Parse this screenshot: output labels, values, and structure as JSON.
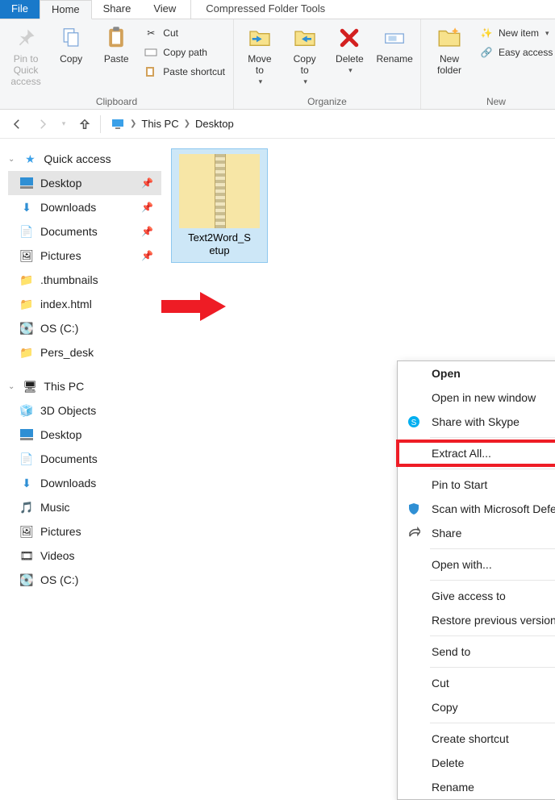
{
  "tabs": {
    "file": "File",
    "home": "Home",
    "share": "Share",
    "view": "View",
    "tool": "Compressed Folder Tools"
  },
  "ribbon": {
    "clipboard": {
      "label": "Clipboard",
      "pin": "Pin to Quick\naccess",
      "copy": "Copy",
      "paste": "Paste",
      "cut": "Cut",
      "copypath": "Copy path",
      "pasteshortcut": "Paste shortcut"
    },
    "organize": {
      "label": "Organize",
      "moveto": "Move\nto",
      "copyto": "Copy\nto",
      "delete": "Delete",
      "rename": "Rename"
    },
    "new": {
      "label": "New",
      "newfolder": "New\nfolder",
      "newitem": "New item",
      "easyaccess": "Easy access"
    }
  },
  "breadcrumb": {
    "root": "This PC",
    "loc": "Desktop"
  },
  "sidebar": {
    "quick": "Quick access",
    "items1": [
      "Desktop",
      "Downloads",
      "Documents",
      "Pictures",
      ".thumbnails",
      "index.html",
      "OS (C:)",
      "Pers_desk"
    ],
    "thispc": "This PC",
    "items2": [
      "3D Objects",
      "Desktop",
      "Documents",
      "Downloads",
      "Music",
      "Pictures",
      "Videos",
      "OS (C:)"
    ]
  },
  "file": {
    "name": "Text2Word_S\netup"
  },
  "context": {
    "open": "Open",
    "openwin": "Open in new window",
    "skype": "Share with Skype",
    "extract": "Extract All...",
    "pin": "Pin to Start",
    "defender": "Scan with Microsoft Defender...",
    "share": "Share",
    "openwith": "Open with...",
    "giveaccess": "Give access to",
    "restore": "Restore previous versions",
    "sendto": "Send to",
    "cut": "Cut",
    "copy": "Copy",
    "shortcut": "Create shortcut",
    "delete": "Delete",
    "rename": "Rename"
  },
  "colors": {
    "accent": "#1979ca",
    "highlight": "#ee1c25"
  }
}
